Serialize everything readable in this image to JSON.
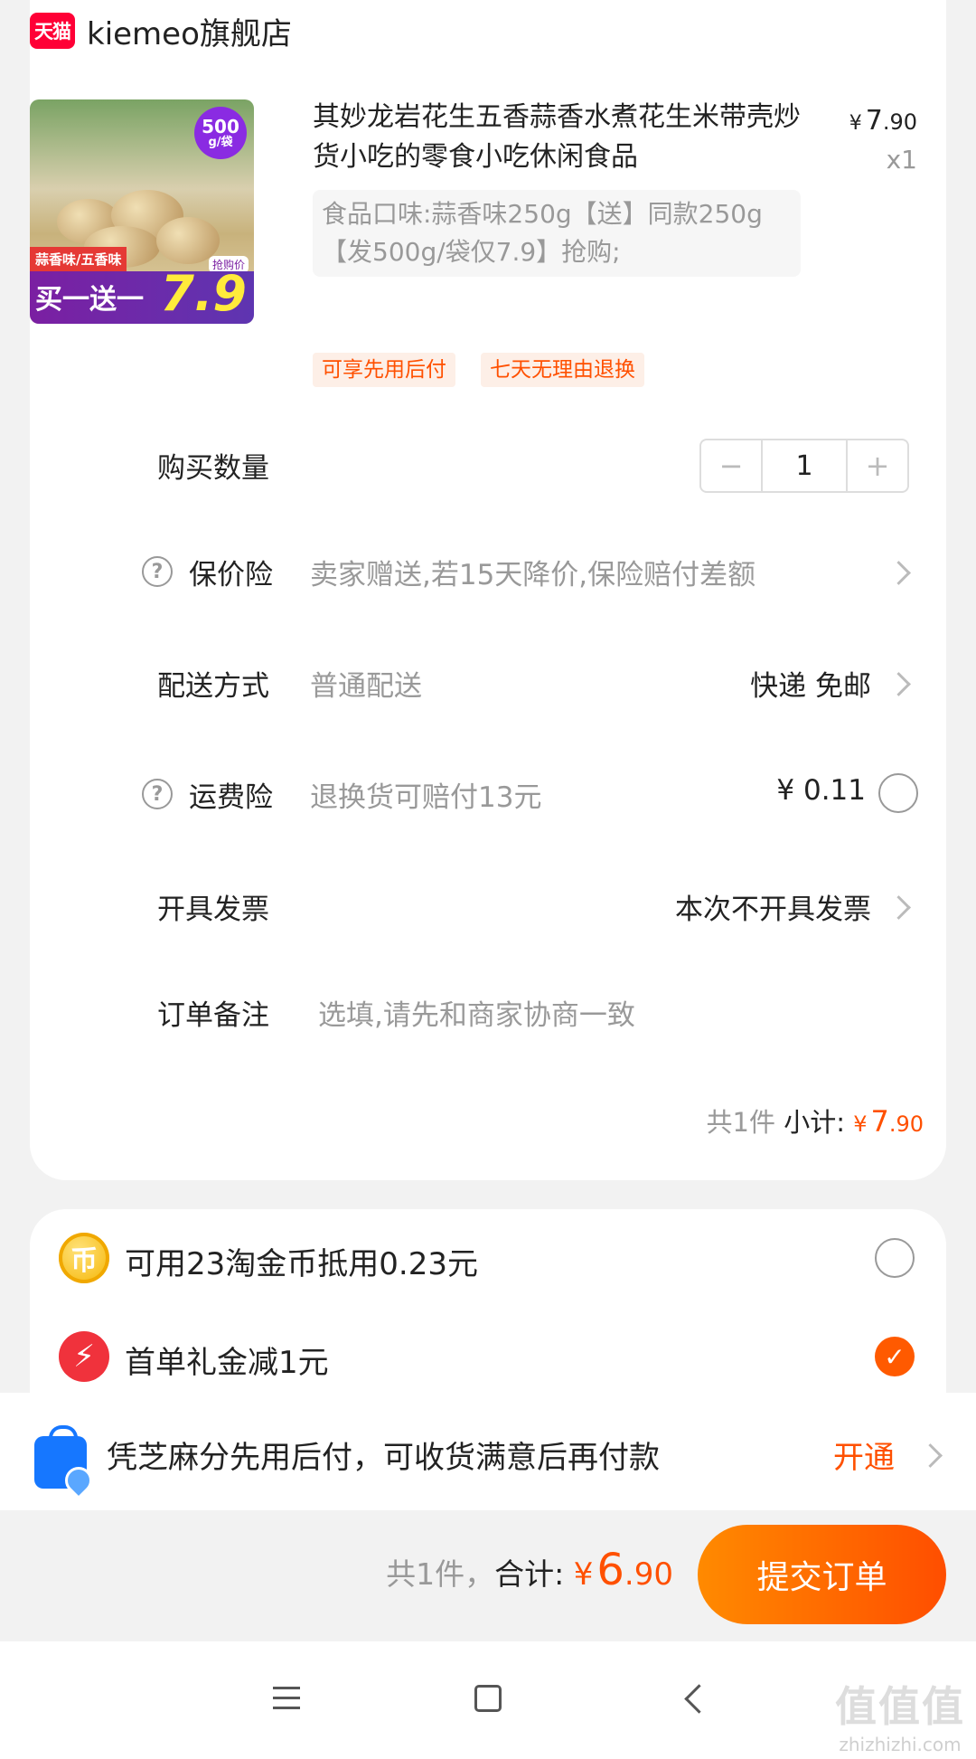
{
  "shop": {
    "badge": "天猫",
    "name": "kiemeo旗舰店"
  },
  "product": {
    "title": "其妙龙岩花生五香蒜香水煮花生米带壳炒货小吃的零食小吃休闲食品",
    "price_symbol": "¥",
    "price_int": "7",
    "price_dec": ".90",
    "quantity_mark": "x1",
    "sku": "食品口味:蒜香味250g【送】同款250g【发500g/袋仅7.9】抢购;",
    "image_text": {
      "weight": "500",
      "unit": "g/袋",
      "flavor": "蒜香味/五香味",
      "promo": "买一送一",
      "rush": "抢购价",
      "price": "7.9"
    },
    "tags": [
      "可享先用后付",
      "七天无理由退换"
    ]
  },
  "rows": {
    "quantity": {
      "label": "购买数量",
      "value": "1",
      "minus": "−",
      "plus": "+"
    },
    "price_protect": {
      "label": "保价险",
      "desc": "卖家赠送,若15天降价,保险赔付差额"
    },
    "delivery": {
      "label": "配送方式",
      "desc": "普通配送",
      "value": "快递 免邮"
    },
    "freight_insurance": {
      "label": "运费险",
      "desc": "退换货可赔付13元",
      "value": "¥ 0.11"
    },
    "invoice": {
      "label": "开具发票",
      "value": "本次不开具发票"
    },
    "note": {
      "label": "订单备注",
      "placeholder": "选填,请先和商家协商一致"
    }
  },
  "subtotal": {
    "count": "共1件",
    "label": "小计:",
    "symbol": "¥",
    "int": "7",
    "dec": ".90"
  },
  "promos": {
    "coins": {
      "text": "可用23淘金币抵用0.23元",
      "checked": false
    },
    "first_order": {
      "text": "首单礼金减1元",
      "checked": true
    }
  },
  "pay_later": {
    "text": "凭芝麻分先用后付，可收货满意后再付款",
    "action": "开通"
  },
  "footer": {
    "count": "共1件，",
    "label": "合计:",
    "symbol": "¥",
    "int": "6",
    "dec": ".90",
    "submit": "提交订单"
  },
  "watermark": {
    "big": "值值值",
    "small": "zhizhizhi.com"
  },
  "colors": {
    "accent": "#ff5000",
    "tmall": "#ff0036",
    "paylater_blue": "#1677ff"
  },
  "icons": {
    "help": "?",
    "coin": "币",
    "bolt": "⚡",
    "check": "✓"
  }
}
